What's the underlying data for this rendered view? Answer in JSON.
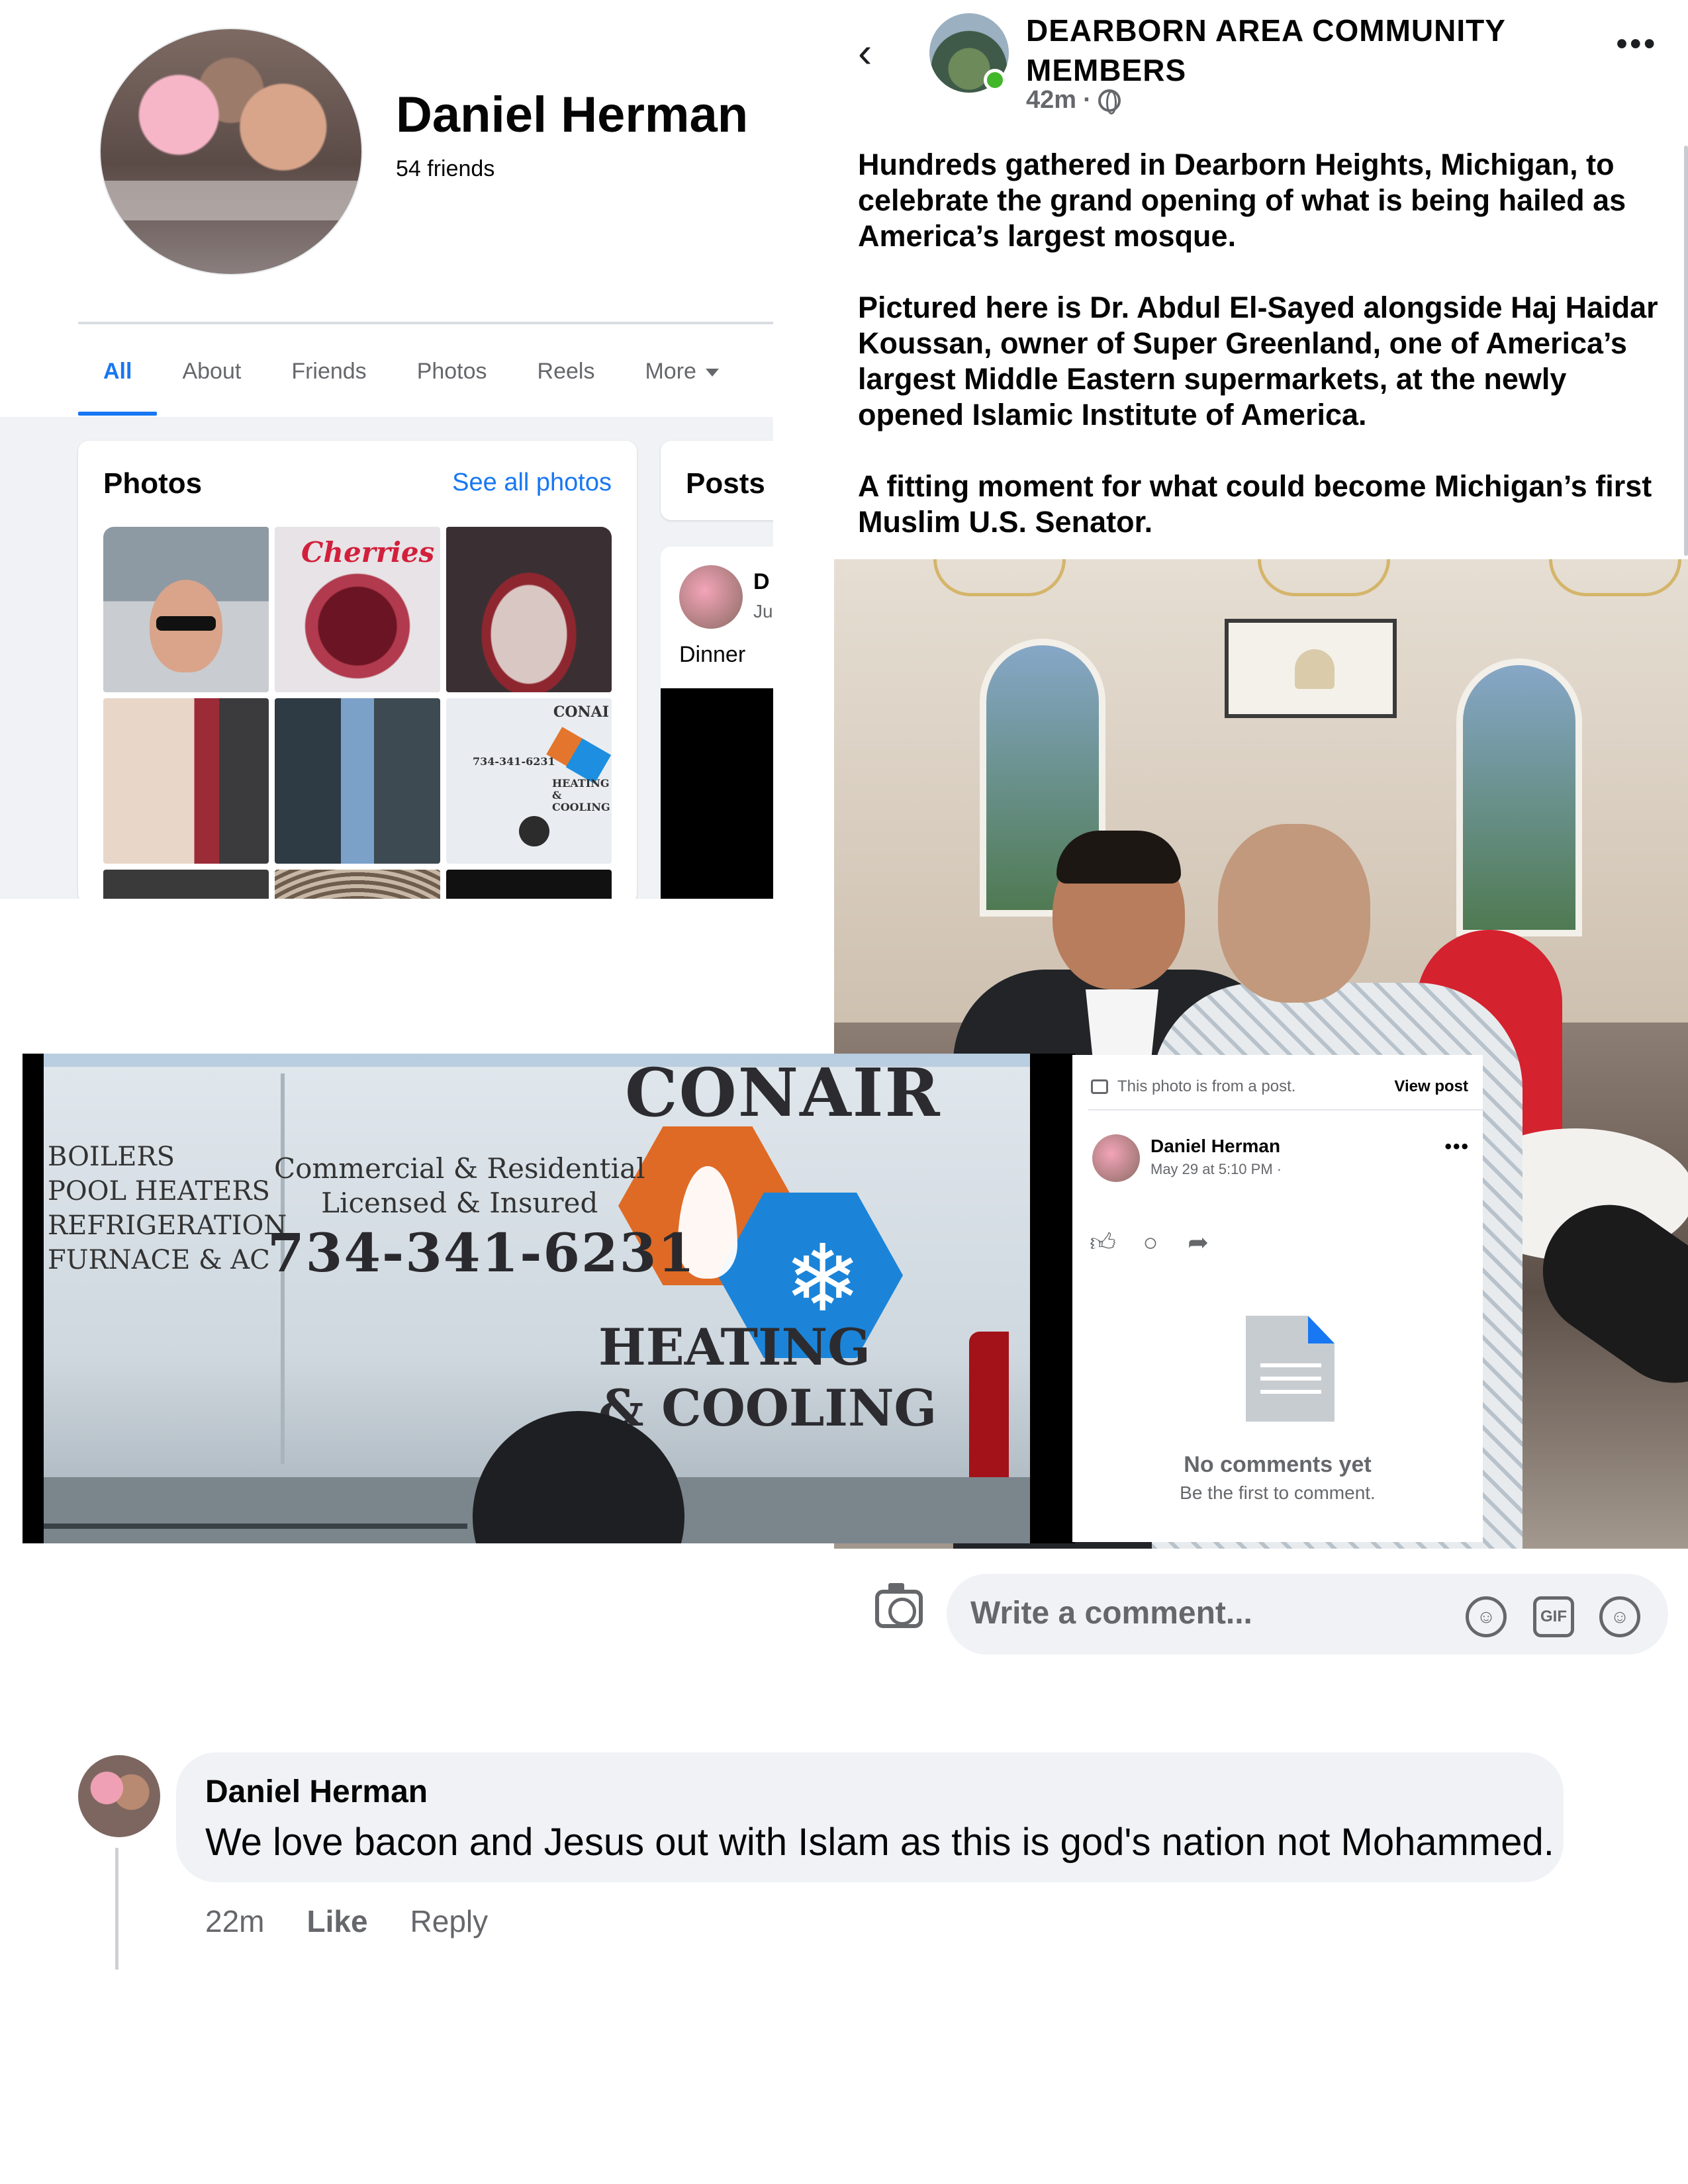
{
  "profile": {
    "name": "Daniel Herman",
    "friends": "54 friends",
    "tabs": [
      "All",
      "About",
      "Friends",
      "Photos",
      "Reels",
      "More"
    ],
    "photos_title": "Photos",
    "see_all": "See all photos",
    "posts_title": "Posts",
    "photo_labels": {
      "cherries": "Cherries",
      "brand": "CONAI",
      "phone": "734-341-6231",
      "heating_cooling": "HEATING & COOLING"
    },
    "post": {
      "author": "D",
      "date": "Ju",
      "text": "Dinner"
    }
  },
  "group_post": {
    "group_name": "DEARBORN AREA COMMUNITY MEMBERS",
    "time": "42m",
    "separator": "·",
    "paragraphs": [
      "Hundreds gathered in Dearborn Heights, Michigan, to celebrate the grand opening of what is being hailed as America’s largest mosque.",
      "Pictured here is Dr. Abdul El-Sayed alongside Haj Haidar Koussan, owner of Super Greenland, one of America’s largest Middle Eastern supermarkets, at the newly opened Islamic Institute of America.",
      "A fitting moment for what could become Michigan’s first Muslim U.S. Senator."
    ]
  },
  "comment_bar": {
    "placeholder": "Write a comment...",
    "gif_label": "GIF"
  },
  "van": {
    "brand": "CONAIR",
    "services": [
      "BOILERS",
      "POOL HEATERS",
      "REFRIGERATION",
      "FURNACE & AC"
    ],
    "tagline_1": "Commercial & Residential",
    "tagline_2": "Licensed & Insured",
    "phone": "734-341-6231",
    "heating": "HEATING",
    "cooling": "& COOLING"
  },
  "photo_card": {
    "from_text": "This photo is from a post.",
    "view_post": "View post",
    "author": "Daniel Herman",
    "date": "May 29 at 5:10 PM ·",
    "no_comments": "No comments yet",
    "be_first": "Be the first to comment."
  },
  "comment": {
    "author": "Daniel Herman",
    "text": "We love bacon and Jesus out with Islam as this is god's nation not Mohammed.",
    "time": "22m",
    "like": "Like",
    "reply": "Reply"
  },
  "colors": {
    "facebook_blue": "#1877f2",
    "secondary_text": "#65676b",
    "bubble_bg": "#f0f2f5",
    "online_green": "#42b72a"
  },
  "icons": [
    "back-arrow-icon",
    "globe-icon",
    "more-dots-icon",
    "camera-icon",
    "avatar-sticker-icon",
    "gif-icon",
    "emoji-icon",
    "like-icon",
    "comment-icon",
    "share-icon",
    "document-icon",
    "caret-down-icon"
  ]
}
